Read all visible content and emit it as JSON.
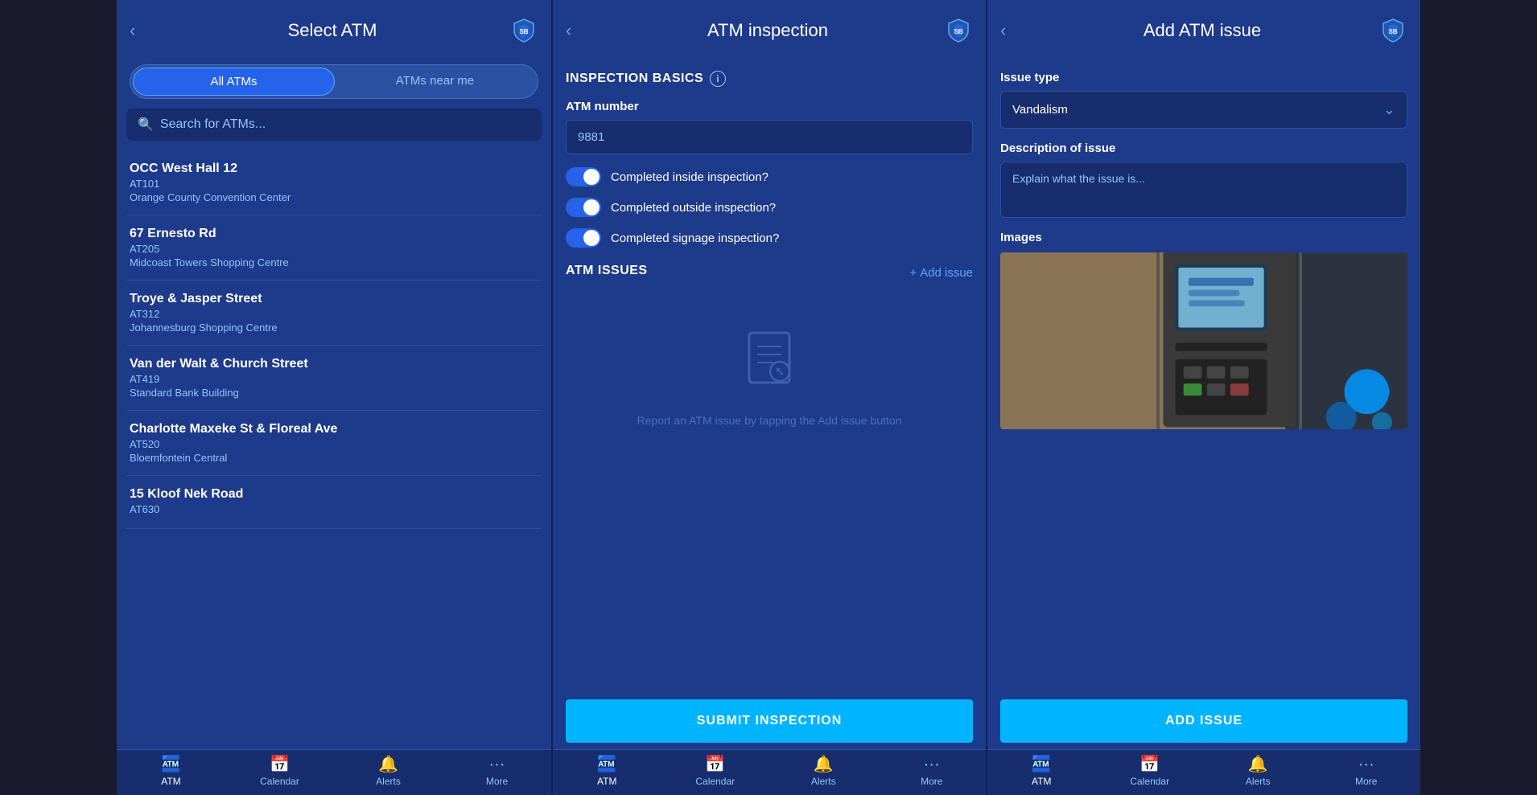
{
  "screens": [
    {
      "id": "select-atm",
      "header": {
        "back_label": "‹",
        "title": "Select ATM"
      },
      "tabs": {
        "all_label": "All ATMs",
        "near_label": "ATMs near me",
        "active": "all"
      },
      "search": {
        "placeholder": "Search for ATMs..."
      },
      "atm_items": [
        {
          "name": "OCC West Hall 12",
          "id": "AT101",
          "location": "Orange County Convention Center"
        },
        {
          "name": "67 Ernesto Rd",
          "id": "AT205",
          "location": "Midcoast Towers Shopping Centre"
        },
        {
          "name": "Troye & Jasper Street",
          "id": "AT312",
          "location": "Johannesburg Shopping Centre"
        },
        {
          "name": "Van der Walt & Church Street",
          "id": "AT419",
          "location": "Standard Bank Building"
        },
        {
          "name": "Charlotte Maxeke St & Floreal Ave",
          "id": "AT520",
          "location": "Bloemfontein Central"
        },
        {
          "name": "15 Kloof Nek Road",
          "id": "AT630",
          "location": ""
        }
      ]
    },
    {
      "id": "atm-inspection",
      "header": {
        "back_label": "‹",
        "title": "ATM inspection"
      },
      "inspection_basics_label": "INSPECTION BASICS",
      "atm_number_label": "ATM number",
      "atm_number_value": "9881",
      "toggles": [
        {
          "label": "Completed inside inspection?",
          "enabled": true
        },
        {
          "label": "Completed outside inspection?",
          "enabled": true
        },
        {
          "label": "Completed signage inspection?",
          "enabled": true
        }
      ],
      "atm_issues_label": "ATM ISSUES",
      "add_issue_label": "Add issue",
      "empty_state_text": "Report an ATM issue by\ntapping the Add issue button",
      "submit_label": "SUBMIT INSPECTION"
    },
    {
      "id": "add-atm-issue",
      "header": {
        "back_label": "‹",
        "title": "Add ATM issue"
      },
      "issue_type_label": "Issue type",
      "issue_type_value": "Vandalism",
      "description_label": "Description of issue",
      "description_placeholder": "Explain what the issue is...",
      "images_label": "Images",
      "add_issue_btn_label": "ADD ISSUE"
    }
  ],
  "bottom_nav": {
    "items": [
      {
        "label": "ATM",
        "icon": "atm",
        "active": true
      },
      {
        "label": "Calendar",
        "icon": "calendar",
        "active": false
      },
      {
        "label": "Alerts",
        "icon": "bell",
        "active": false
      },
      {
        "label": "More",
        "icon": "more",
        "active": false
      }
    ]
  },
  "colors": {
    "primary": "#1e3a8a",
    "accent": "#2563eb",
    "light_blue": "#00b4ff",
    "text_primary": "#ffffff",
    "text_secondary": "#93c5fd"
  }
}
